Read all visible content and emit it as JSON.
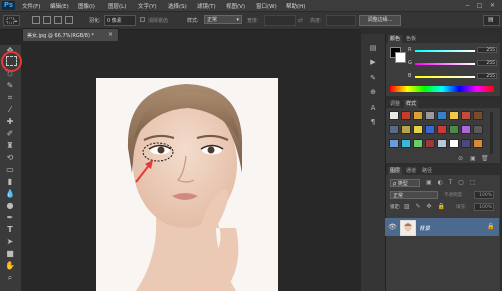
{
  "app": {
    "logo": "Ps"
  },
  "menubar": {
    "items": [
      "文件(F)",
      "编辑(E)",
      "图像(I)",
      "图层(L)",
      "文字(Y)",
      "选择(S)",
      "滤镜(T)",
      "视图(V)",
      "窗口(W)",
      "帮助(H)"
    ]
  },
  "window_controls": {
    "minimize": "−",
    "maximize": "□",
    "close": "✕"
  },
  "options": {
    "feather_label": "羽化:",
    "feather_value": "0 像素",
    "antialias_label": "消除锯齿",
    "style_label": "样式:",
    "style_value": "正常",
    "width_label": "宽度:",
    "height_label": "高度:",
    "refine_edge_button": "调整边缘..."
  },
  "document": {
    "tab_label": "美女.jpg @ 66.7%(RGB/8) *",
    "close": "×"
  },
  "color_panel": {
    "tabs": [
      "颜色",
      "色板"
    ],
    "channels": [
      {
        "label": "R",
        "value": "255",
        "color": "#e53935"
      },
      {
        "label": "G",
        "value": "255",
        "color": "#43a047"
      },
      {
        "label": "B",
        "value": "255",
        "color": "#1e88e5"
      }
    ]
  },
  "styles_panel": {
    "tabs": [
      "调整",
      "样式"
    ],
    "swatches": [
      "#e8e8e8",
      "#c63b2b",
      "#d9a03a",
      "#9a9a9a",
      "#3c7fc8",
      "#f1c74a",
      "#c44a3a",
      "#7a4a2a",
      "#5a6a8a",
      "#b8a24a",
      "#e6d04a",
      "#3a6acd",
      "#c93a3a",
      "#4a8a4a",
      "#a86ad8",
      "#5a5a5a",
      "#6a9ad8",
      "#3ab8d8",
      "#6acd6a",
      "#9a3a3a",
      "#b8c8d8",
      "#ffffff",
      "#4a4a7a",
      "#d88a3a"
    ]
  },
  "layers_panel": {
    "tabs": [
      "图层",
      "通道",
      "路径"
    ],
    "kind_label": "ρ 类型",
    "blend_mode": "正常",
    "opacity_label": "不透明度:",
    "opacity_value": "100%",
    "lock_label": "锁定:",
    "fill_label": "填充:",
    "fill_value": "100%",
    "layer_name": "背景"
  }
}
